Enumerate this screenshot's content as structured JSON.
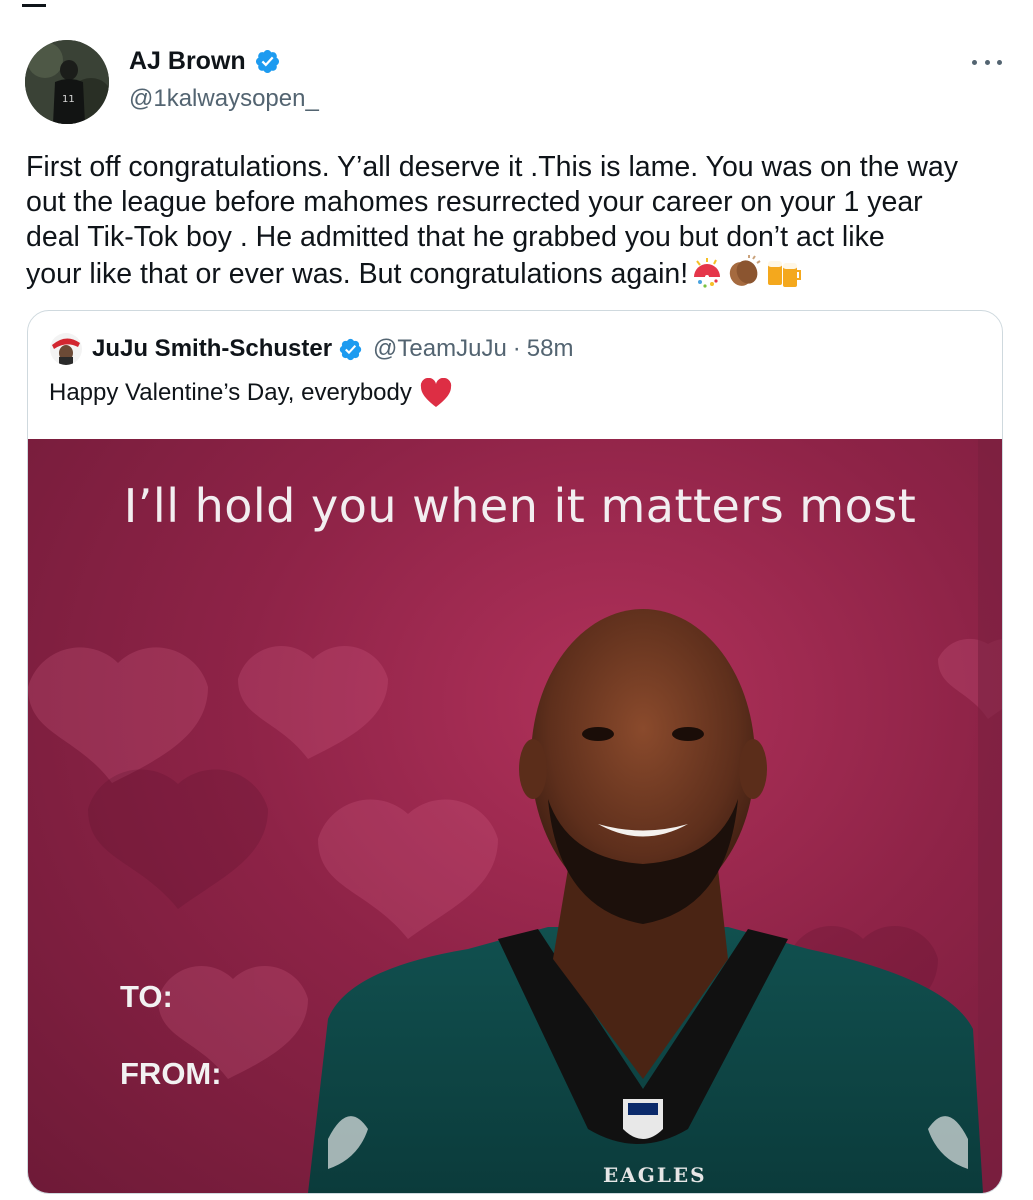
{
  "post": {
    "author_name": "AJ Brown",
    "author_handle": "@1kalwaysopen_",
    "more_icon": "more-horizontal-icon",
    "text": "First off congratulations. Y’all deserve it .This is lame. You was on the way\nout the league before mahomes resurrected your career on your 1 year\ndeal Tik-Tok boy . He admitted that he grabbed you but don’t act like\nyour like that or ever was. But congratulations again!",
    "emojis": [
      "confetti-ball-icon",
      "clapping-hands-icon",
      "beer-mugs-icon"
    ]
  },
  "quote": {
    "author_name": "JuJu Smith-Schuster",
    "author_handle": "@TeamJuJu",
    "separator": "·",
    "time_ago": "58m",
    "text": "Happy Valentine’s Day, everybody",
    "text_emoji": "red-heart-icon",
    "media": {
      "headline": "I’ll hold you when it matters most",
      "to_label": "TO:",
      "from_label": "FROM:",
      "jersey_text": "EAGLES"
    }
  },
  "colors": {
    "verified_blue": "#1d9bf0",
    "secondary_text": "#536471",
    "card_border": "#cfd9de",
    "card_background": "#8e2347"
  }
}
